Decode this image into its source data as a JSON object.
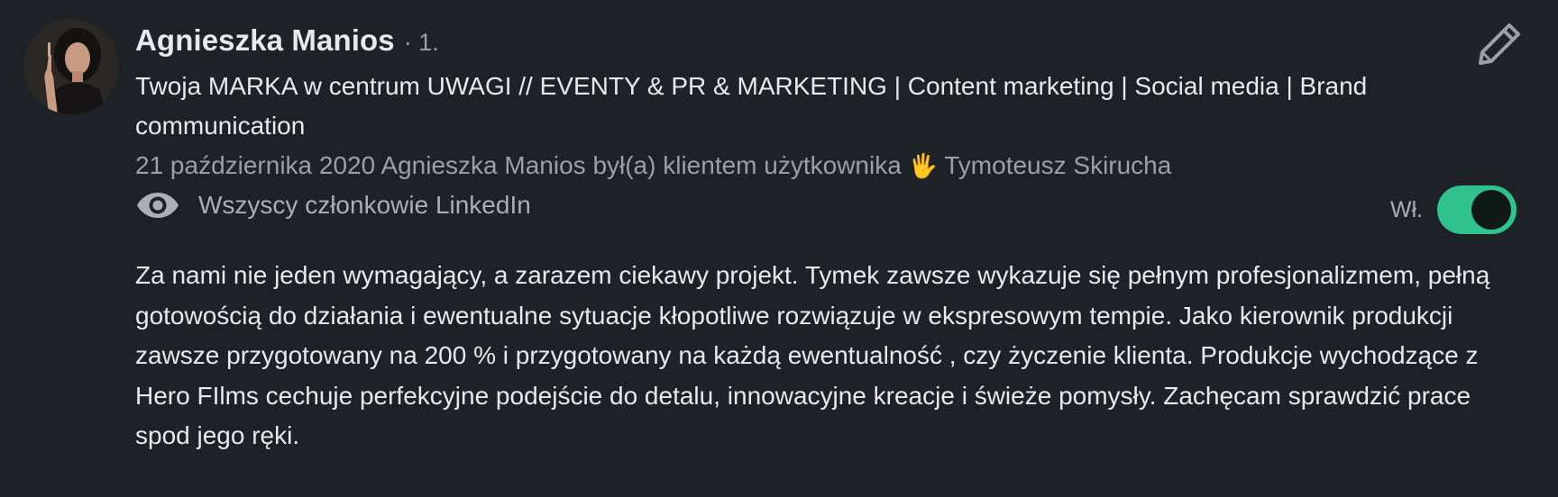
{
  "recommendation": {
    "author": {
      "name": "Agnieszka Manios",
      "degree": "· 1.",
      "headline": "Twoja MARKA w centrum UWAGI // EVENTY & PR & MARKETING | Content marketing | Social media | Brand communication"
    },
    "meta": {
      "date": "21 października 2020",
      "relation_text": "Agnieszka Manios był(a) klientem użytkownika",
      "hand_emoji": "🖐",
      "recipient": "Tymoteusz Skirucha"
    },
    "visibility": {
      "label": "Wszyscy członkowie LinkedIn",
      "icon": "eye-icon"
    },
    "toggle": {
      "label": "Wł.",
      "state": "on",
      "color_on": "#2fc28f"
    },
    "edit": {
      "icon": "pencil-icon"
    },
    "body": "Za nami nie jeden wymagający, a zarazem ciekawy projekt. Tymek zawsze wykazuje się pełnym profesjonalizmem, pełną gotowością do działania i ewentualne sytuacje kłopotliwe rozwiązuje w ekspresowym tempie. Jako kierownik produkcji zawsze przygotowany na 200 % i przygotowany na każdą ewentualność , czy życzenie klienta. Produkcje wychodzące z Hero FIlms cechuje perfekcyjne podejście do detalu, innowacyjne kreacje i świeże pomysły. Zachęcam sprawdzić prace spod jego ręki."
  }
}
